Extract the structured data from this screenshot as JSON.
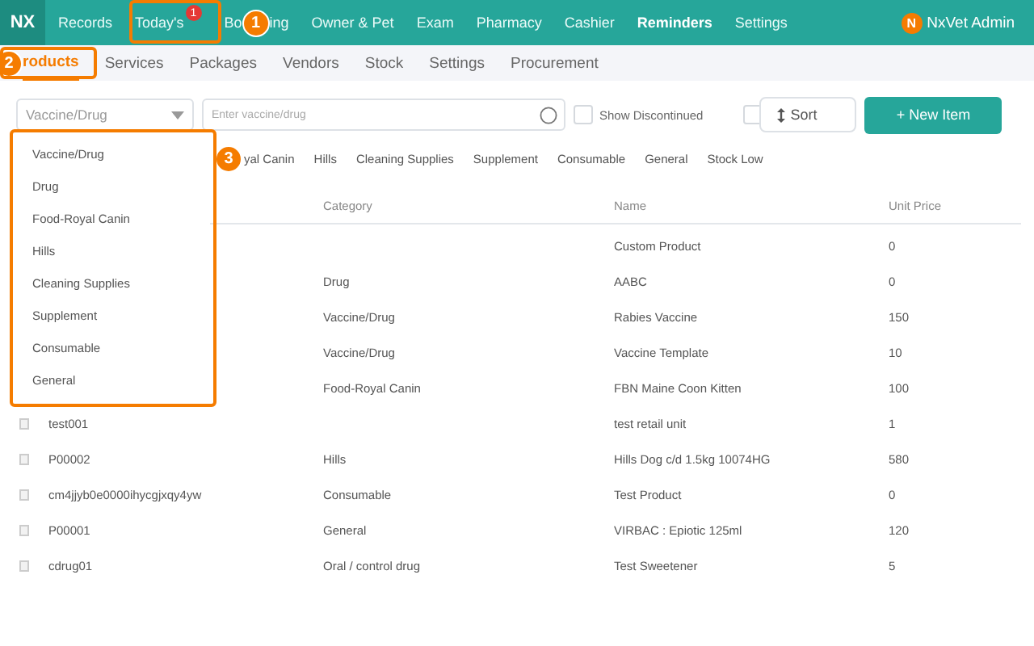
{
  "nav": {
    "logo": "NX",
    "items": [
      {
        "label": "Records",
        "selected": false
      },
      {
        "label": "Today's",
        "selected": false,
        "badge": "1"
      },
      {
        "label": "Bo",
        "label_end": "ing",
        "marker": "1",
        "selected": false
      },
      {
        "label": "Owner & Pet",
        "selected": false
      },
      {
        "label": "Exam",
        "selected": false
      },
      {
        "label": "Pharmacy",
        "selected": false
      },
      {
        "label": "Cashier",
        "selected": false
      },
      {
        "label": "Reminders",
        "selected": true
      },
      {
        "label": "Settings",
        "selected": false
      }
    ],
    "user": {
      "initial": "N",
      "name": "NxVet Admin"
    }
  },
  "tabs": [
    {
      "label": "roducts",
      "marker": "2",
      "selected": true
    },
    {
      "label": "Services",
      "selected": false
    },
    {
      "label": "Packages",
      "selected": false
    },
    {
      "label": "Vendors",
      "selected": false
    },
    {
      "label": "Stock",
      "selected": false
    },
    {
      "label": "Settings",
      "selected": false
    },
    {
      "label": "Procurement",
      "selected": false
    }
  ],
  "filters": {
    "category_select": {
      "value": "Vaccine/Drug"
    },
    "search": {
      "placeholder": "Enter vaccine/drug"
    },
    "show_discontinued": {
      "label": "Show Discontinued",
      "checked": false
    },
    "checkbox_2": {
      "checked": false
    },
    "sort_button": "Sort",
    "new_button": "+ New Item"
  },
  "category_chips": {
    "marker": "3",
    "items": [
      "yal Canin",
      "Hills",
      "Cleaning Supplies",
      "Supplement",
      "Consumable",
      "General",
      "Stock Low"
    ]
  },
  "dropdown": {
    "options": [
      "Vaccine/Drug",
      "Drug",
      "Food-Royal Canin",
      "Hills",
      "Cleaning Supplies",
      "Supplement",
      "Consumable",
      "General"
    ]
  },
  "table": {
    "columns": [
      "Category",
      "Name",
      "Unit Price"
    ],
    "rows": [
      {
        "category": "",
        "name": "Custom Product",
        "unit_price": "0"
      },
      {
        "category": "Drug",
        "name": "AABC",
        "unit_price": "0"
      },
      {
        "category": "Vaccine/Drug",
        "name": "Rabies Vaccine",
        "unit_price": "150"
      },
      {
        "category": "Vaccine/Drug",
        "name": "Vaccine Template",
        "unit_price": "10"
      },
      {
        "category": "Food-Royal Canin",
        "name": "FBN Maine Coon Kitten",
        "unit_price": "100"
      },
      {
        "code": "test001",
        "category": "",
        "name": "test retail unit",
        "unit_price": "1"
      },
      {
        "code": "P00002",
        "category": "Hills",
        "name": "Hills Dog c/d 1.5kg 10074HG",
        "unit_price": "580"
      },
      {
        "code": "cm4jjyb0e0000ihycgjxqy4yw",
        "category": "Consumable",
        "name": "Test Product",
        "unit_price": "0"
      },
      {
        "code": "P00001",
        "category": "General",
        "name": "VIRBAC : Epiotic 125ml",
        "unit_price": "120"
      },
      {
        "code": "cdrug01",
        "category": "Oral / control drug",
        "name": "Test Sweetener",
        "unit_price": "5"
      }
    ]
  }
}
